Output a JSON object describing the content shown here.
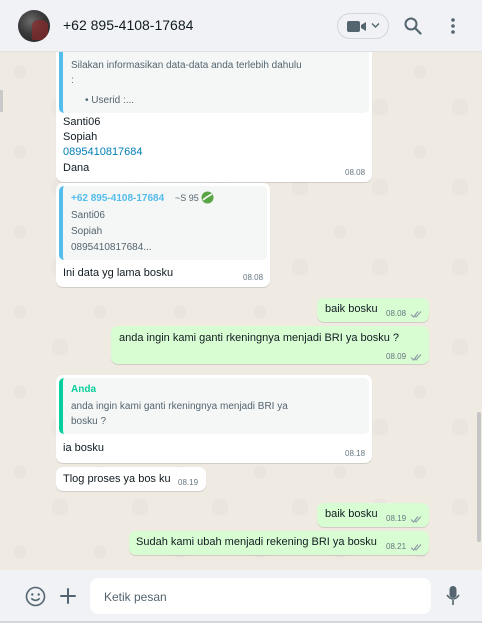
{
  "header": {
    "contact_name": "+62 895-4108-17684",
    "icons": [
      "video-call-icon",
      "chevron-down-icon",
      "search-icon",
      "menu-icon"
    ]
  },
  "messages": {
    "m1": {
      "quote_line1": "Silakan informasikan data-data anda terlebih dahulu",
      "quote_line2": ":",
      "quote_line3": "•  Userid :...",
      "line1": "Santi06",
      "line2": "Sopiah",
      "line3": "0895410817684",
      "line4": "Dana",
      "time": "08.08"
    },
    "m2": {
      "quote_author": "+62 895-4108-17684",
      "quote_author_extra": "~S 95",
      "quote_line1": "Santi06",
      "quote_line2": "Sopiah",
      "quote_line3": "0895410817684...",
      "text": "Ini data yg lama bosku",
      "time": "08.08"
    },
    "m3": {
      "text": "baik bosku",
      "time": "08.08"
    },
    "m4": {
      "text": "anda ingin kami ganti rkeningnya menjadi BRI ya bosku ?",
      "time": "08.09"
    },
    "m5": {
      "quote_author": "Anda",
      "quote_line1": "anda ingin kami ganti rkeningnya menjadi BRI ya",
      "quote_line2": "bosku ?",
      "text": "ia bosku",
      "time": "08.18"
    },
    "m6": {
      "text": "Tlog proses ya bos ku",
      "time": "08.19"
    },
    "m7": {
      "text": "baik bosku",
      "time": "08.19"
    },
    "m8": {
      "text": "Sudah kami ubah menjadi rekening BRI ya bosku",
      "time": "08.21"
    }
  },
  "footer": {
    "placeholder": "Ketik pesan",
    "icons": [
      "emoji-icon",
      "plus-icon",
      "microphone-icon"
    ]
  },
  "colors": {
    "chat_bg": "#efeae2",
    "outgoing_bubble": "#d9fdd3",
    "incoming_bubble": "#ffffff",
    "read_ticks": "#53bdeb",
    "link": "#027eb5"
  }
}
